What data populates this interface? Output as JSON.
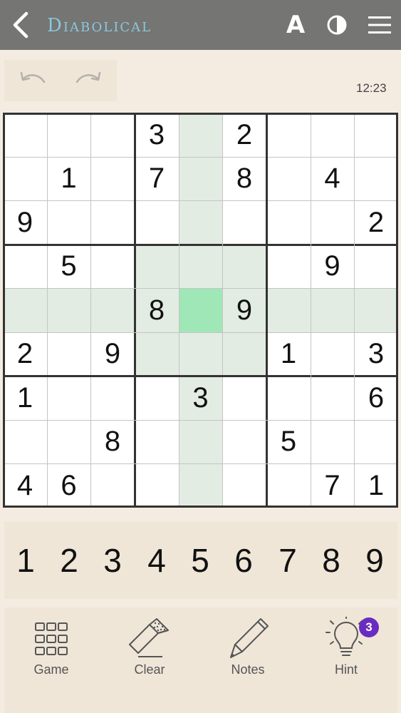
{
  "header": {
    "title": "Diabolical",
    "font_icon_glyph": "A",
    "icons": [
      "back-arrow-icon",
      "font-size-icon",
      "contrast-icon",
      "menu-icon"
    ]
  },
  "history": {
    "icons": [
      "undo-icon",
      "redo-icon"
    ]
  },
  "timer": "12:23",
  "board": {
    "grid": [
      [
        "",
        "",
        "",
        "3",
        "",
        "2",
        "",
        "",
        ""
      ],
      [
        "",
        "1",
        "",
        "7",
        "",
        "8",
        "",
        "4",
        ""
      ],
      [
        "9",
        "",
        "",
        "",
        "",
        "",
        "",
        "",
        "2"
      ],
      [
        "",
        "5",
        "",
        "",
        "",
        "",
        "",
        "9",
        ""
      ],
      [
        "",
        "",
        "",
        "8",
        "",
        "9",
        "",
        "",
        ""
      ],
      [
        "2",
        "",
        "9",
        "",
        "",
        "",
        "1",
        "",
        "3"
      ],
      [
        "1",
        "",
        "",
        "",
        "3",
        "",
        "",
        "",
        "6"
      ],
      [
        "",
        "",
        "8",
        "",
        "",
        "",
        "5",
        "",
        ""
      ],
      [
        "4",
        "6",
        "",
        "",
        "",
        "",
        "",
        "7",
        "1"
      ]
    ],
    "selected": {
      "row": 5,
      "col": 5
    },
    "colors": {
      "selected": "#9fe7b6",
      "highlight": "#e3ece3",
      "cell": "#ffffff",
      "thick_line": "#333333",
      "thin_line": "#c4c4c4"
    }
  },
  "numpad": [
    "1",
    "2",
    "3",
    "4",
    "5",
    "6",
    "7",
    "8",
    "9"
  ],
  "tools": {
    "game": {
      "label": "Game",
      "icon": "grid-icon"
    },
    "clear": {
      "label": "Clear",
      "icon": "eraser-icon"
    },
    "notes": {
      "label": "Notes",
      "icon": "pencil-icon"
    },
    "hint": {
      "label": "Hint",
      "icon": "lightbulb-icon",
      "badge": "3"
    }
  },
  "colors": {
    "topbar": "#757573",
    "title": "#8ac7dd",
    "background": "#f4ece1",
    "panel": "#efe6d8",
    "badge": "#6a2bc0"
  }
}
